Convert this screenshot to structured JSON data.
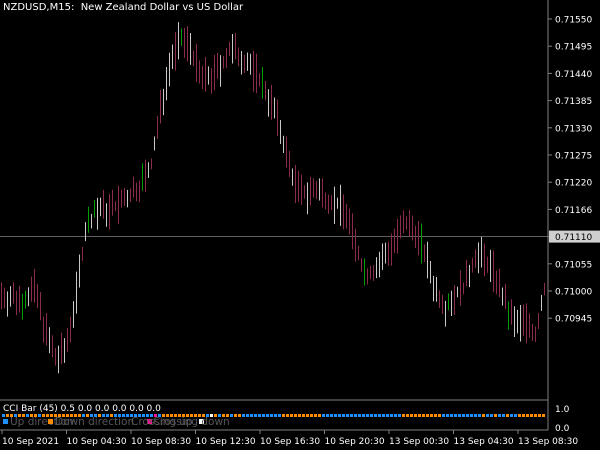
{
  "chart": {
    "symbol": "NZDUSD",
    "timeframe": "M15",
    "description": "New Zealand Dollar vs US Dollar",
    "current_price": "0.71110",
    "price_ticks": [
      "0.71550",
      "0.71495",
      "0.71440",
      "0.71385",
      "0.71330",
      "0.71275",
      "0.71220",
      "0.71166",
      "0.71110",
      "0.71055",
      "0.71000",
      "0.70945"
    ],
    "time_ticks": [
      "10 Sep 2021",
      "10 Sep 04:30",
      "10 Sep 08:30",
      "10 Sep 12:30",
      "10 Sep 16:30",
      "10 Sep 20:30",
      "13 Sep 00:30",
      "13 Sep 04:30",
      "13 Sep 08:30"
    ],
    "colors": {
      "background": "#000000",
      "bull": "#00a000",
      "bear": "#8b2c4a",
      "neutral": "#c8c8c8",
      "grid": "#808080",
      "axis_text": "#ffffff"
    }
  },
  "indicator": {
    "label": "CCI Bar (45) 0.5 0.0 0.0 0.0 0.0 0.0",
    "scale_top": "1.0",
    "scale_bottom": "0.0",
    "legend": [
      {
        "text": "Up direction",
        "color": "#1e90ff"
      },
      {
        "text": "Down direction",
        "color": "#ff8c00"
      },
      {
        "text": "Crossing up",
        "color": "#ff1493"
      },
      {
        "text": "Crossing down",
        "color": "#ffffff"
      }
    ]
  }
}
